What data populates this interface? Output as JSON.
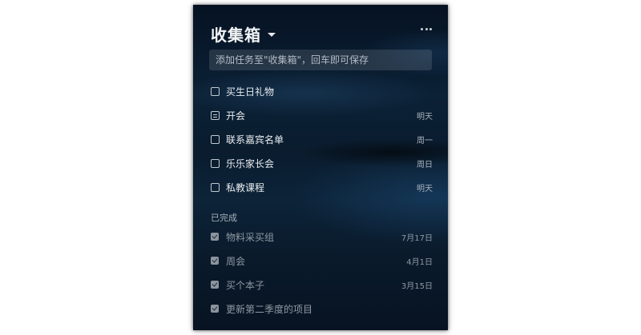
{
  "header": {
    "title": "收集箱"
  },
  "add_task": {
    "placeholder": "添加任务至\"收集箱\"，回车即可保存"
  },
  "tasks": [
    {
      "title": "买生日礼物",
      "date": "",
      "kind": "checkbox"
    },
    {
      "title": "开会",
      "date": "明天",
      "kind": "note"
    },
    {
      "title": "联系嘉宾名单",
      "date": "周一",
      "kind": "checkbox"
    },
    {
      "title": "乐乐家长会",
      "date": "周日",
      "kind": "checkbox"
    },
    {
      "title": "私教课程",
      "date": "明天",
      "kind": "checkbox"
    }
  ],
  "completed": {
    "label": "已完成",
    "tasks": [
      {
        "title": "物料采买组",
        "date": "7月17日"
      },
      {
        "title": "周会",
        "date": "4月1日"
      },
      {
        "title": "买个本子",
        "date": "3月15日"
      },
      {
        "title": "更新第二季度的项目",
        "date": ""
      }
    ]
  },
  "icons": {
    "dropdown": "caret-down-icon",
    "more": "more-icon",
    "task_checkbox": "checkbox-icon",
    "note_task": "note-checkbox-icon",
    "completed_check": "checked-box-icon"
  },
  "colors": {
    "panel_top": "#061222",
    "panel_mid": "#0b2136",
    "text_primary": "#e9edf1",
    "text_muted": "#8f99a3"
  }
}
